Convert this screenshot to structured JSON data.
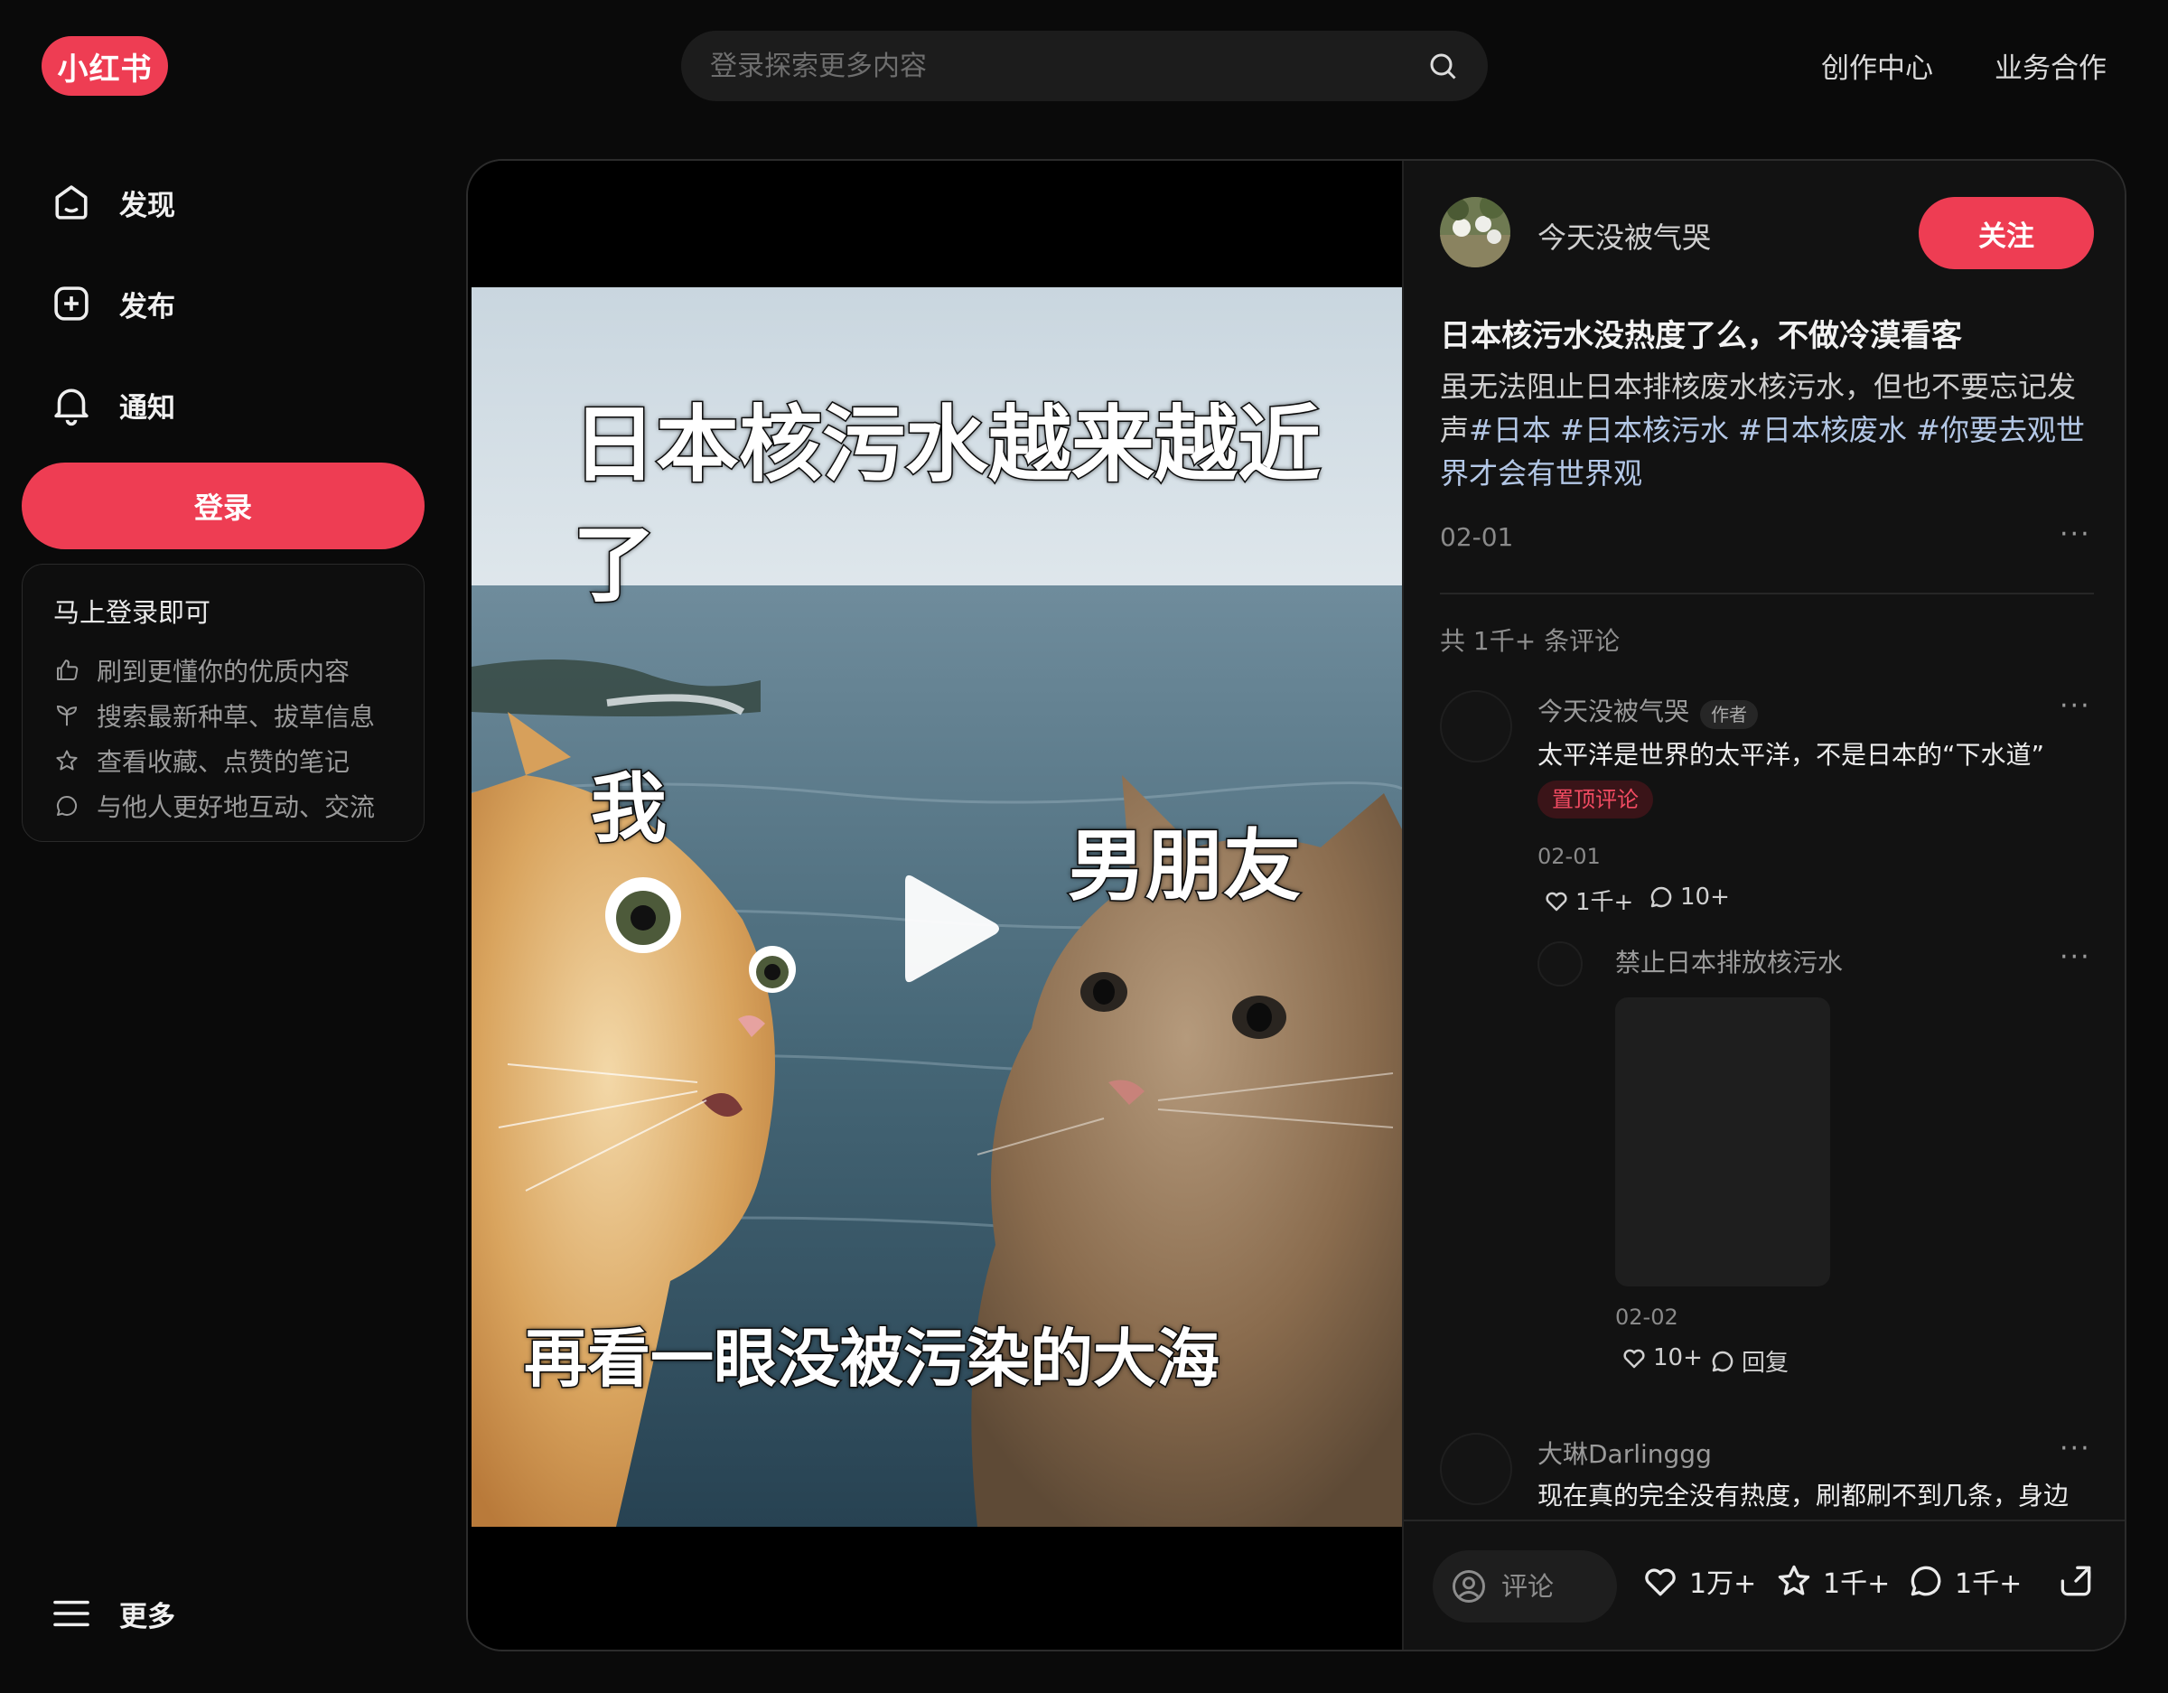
{
  "brand": {
    "logo_text": "小红书",
    "accent": "#ee3d53"
  },
  "header": {
    "search_placeholder": "登录探索更多内容",
    "links": [
      "创作中心",
      "业务合作"
    ]
  },
  "sidebar": {
    "items": [
      {
        "label": "发现",
        "icon": "home-icon"
      },
      {
        "label": "发布",
        "icon": "plus-square-icon"
      },
      {
        "label": "通知",
        "icon": "bell-icon"
      }
    ],
    "login_label": "登录",
    "login_card": {
      "title": "马上登录即可",
      "benefits": [
        {
          "text": "刷到更懂你的优质内容",
          "icon": "thumbs-up-icon"
        },
        {
          "text": "搜索最新种草、拔草信息",
          "icon": "sprout-icon"
        },
        {
          "text": "查看收藏、点赞的笔记",
          "icon": "star-icon"
        },
        {
          "text": "与他人更好地互动、交流",
          "icon": "chat-icon"
        }
      ]
    },
    "more_label": "更多"
  },
  "media": {
    "caption_top": "日本核污水越来越近了",
    "label_left": "我",
    "label_right": "男朋友",
    "caption_bottom": "再看一眼没被污染的大海"
  },
  "note": {
    "author": "今天没被气哭",
    "follow_label": "关注",
    "title": "日本核污水没热度了么，不做冷漠看客",
    "desc_text": "虽无法阻止日本排核废水核污水，但也不要忘记发声",
    "tags": [
      "#日本",
      "#日本核污水",
      "#日本核废水",
      "#你要去观世界才会有世界观"
    ],
    "date": "02-01",
    "more": "···"
  },
  "comments": {
    "count_text": "共 1千+ 条评论",
    "list": [
      {
        "name": "今天没被气哭",
        "author_tag": "作者",
        "text": "太平洋是世界的太平洋，不是日本的“下水道”",
        "pinned": "置顶评论",
        "date": "02-01",
        "likes": "1千+",
        "replies": "10+"
      }
    ],
    "reply": {
      "name": "禁止日本排放核污水",
      "date": "02-02",
      "likes": "10+",
      "reply_label": "回复"
    },
    "third": {
      "name": "大琳Darlinggg",
      "text": "现在真的完全没有热度，刷都刷不到几条，身边"
    }
  },
  "bottom": {
    "comment_placeholder": "评论",
    "likes": "1万+",
    "collects": "1千+",
    "comments": "1千+"
  }
}
